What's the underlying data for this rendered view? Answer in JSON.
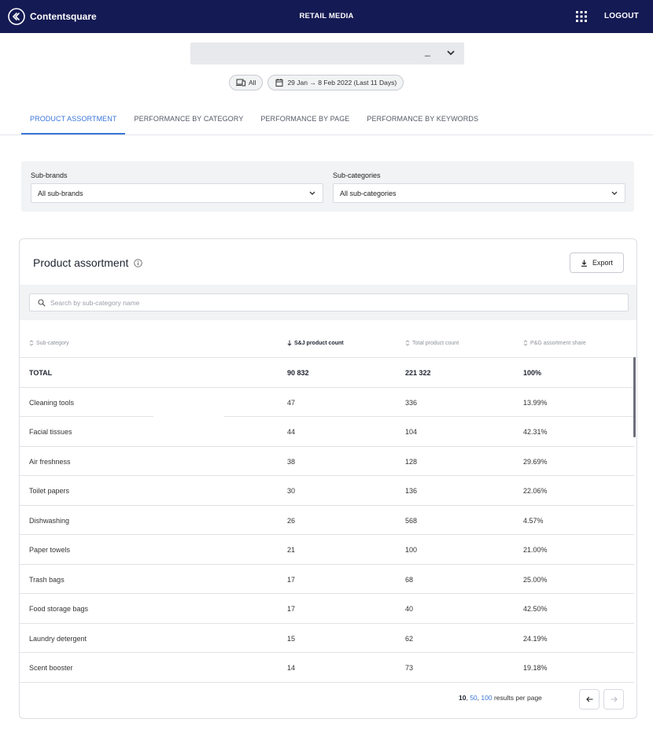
{
  "header": {
    "brand": "Contentsquare",
    "title": "RETAIL MEDIA",
    "logout": "LOGOUT",
    "apps_icon": "grid-icon",
    "brand_color": "#141a53"
  },
  "selector": {
    "value": "_"
  },
  "chips": {
    "device": "All",
    "dates": "29 Jan → 8 Feb 2022 (Last 11 Days)"
  },
  "tabs": [
    "PRODUCT ASSORTMENT",
    "PERFORMANCE BY CATEGORY",
    "PERFORMANCE BY PAGE",
    "PERFORMANCE BY KEYWORDS"
  ],
  "active_tab": "PRODUCT ASSORTMENT",
  "accent_color": "#3b76d9",
  "filters": {
    "sub_brands_label": "Sub-brands",
    "sub_brands_value": "All sub-brands",
    "sub_categories_label": "Sub-categories",
    "sub_categories_value": "All sub-categories"
  },
  "card": {
    "title": "Product assortment",
    "export": "Export",
    "search_placeholder": "Search by sub-category name",
    "columns": [
      "Sub-category",
      "S&J product count",
      "Total product count",
      "P&G assortment share"
    ],
    "total_row": [
      "TOTAL",
      "90 832",
      "221 322",
      "100%"
    ],
    "rows": [
      [
        "Cleaning tools",
        "47",
        "336",
        "13.99%"
      ],
      [
        "Facial tissues",
        "44",
        "104",
        "42.31%"
      ],
      [
        "Air freshness",
        "38",
        "128",
        "29.69%"
      ],
      [
        "Toilet papers",
        "30",
        "136",
        "22.06%"
      ],
      [
        "Dishwashing",
        "26",
        "568",
        "4.57%"
      ],
      [
        "Paper towels",
        "21",
        "100",
        "21.00%"
      ],
      [
        "Trash bags",
        "17",
        "68",
        "25.00%"
      ],
      [
        "Food storage bags",
        "17",
        "40",
        "42.50%"
      ],
      [
        "Laundry detergent",
        "15",
        "62",
        "24.19%"
      ],
      [
        "Scent booster",
        "14",
        "73",
        "19.18%"
      ]
    ],
    "pagination": {
      "opt_10": "10",
      "opt_50": "50",
      "opt_100": "100",
      "suffix": " results per page",
      "sep": ", "
    }
  }
}
